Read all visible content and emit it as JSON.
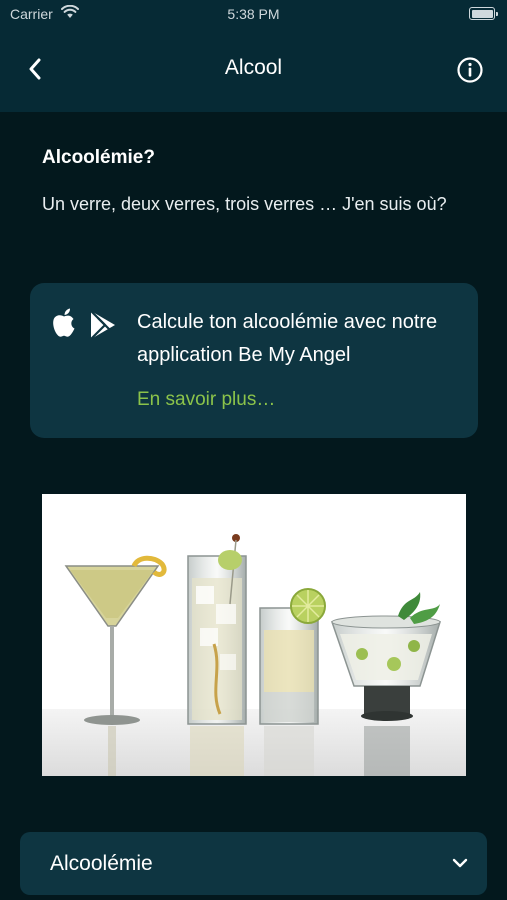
{
  "status_bar": {
    "carrier": "Carrier",
    "time": "5:38 PM"
  },
  "nav": {
    "title": "Alcool"
  },
  "section": {
    "title": "Alcoolémie?",
    "text": "Un verre, deux verres, trois verres … J'en suis où?"
  },
  "promo": {
    "text": "Calcule ton alcoolémie avec notre application Be My Angel",
    "link": "En savoir plus…",
    "link_color": "#8bc34a",
    "icons": [
      "apple-icon",
      "play-store-icon"
    ]
  },
  "photo": {
    "subject": "cocktail-glasses"
  },
  "accordion": {
    "label": "Alcoolémie",
    "icon": "chevron-down-icon"
  },
  "colors": {
    "background": "#03181d",
    "header": "#062a35",
    "card": "#0e3541",
    "accent": "#8bc34a"
  }
}
